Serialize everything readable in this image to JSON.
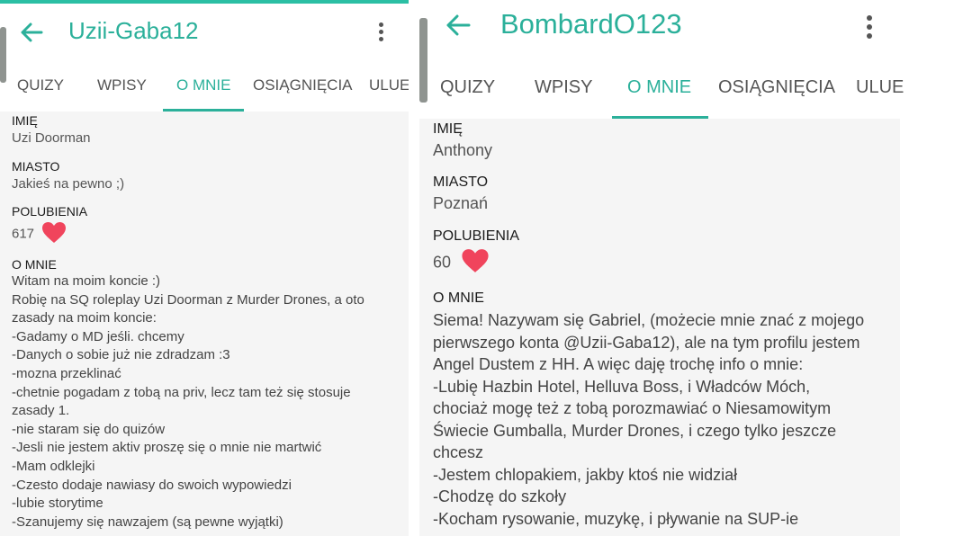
{
  "left": {
    "app_bar": {
      "title": "Uzii-Gaba12"
    },
    "tabs": [
      "QUIZY",
      "WPISY",
      "O MNIE",
      "OSIĄGNIĘCIA",
      "ULUE"
    ],
    "active_tab": "O MNIE",
    "fields": {
      "name_label": "IMIĘ",
      "name_value": "Uzi Doorman",
      "city_label": "MIASTO",
      "city_value": "Jakieś na pewno ;)",
      "likes_label": "POLUBIENIA",
      "likes_value": "617",
      "about_label": "O MNIE"
    },
    "about_lines": [
      "Witam na moim koncie :)",
      "Robię na SQ roleplay Uzi Doorman z Murder Drones, a oto",
      "zasady na moim koncie:",
      "-Gadamy o MD jeśli. chcemy",
      "-Danych o sobie już nie zdradzam :3",
      "-mozna przeklinać",
      "-chetnie pogadam z tobą na priv, lecz tam też się stosuje",
      "zasady 1.",
      "-nie staram się do quizów",
      "-Jesli nie jestem aktiv proszę się o mnie nie martwić",
      "-Mam odklejki",
      "-Czesto dodaje nawiasy do swoich wypowiedzi",
      "-lubie storytime",
      "-Szanujemy się nawzajem (są pewne wyjątki)"
    ]
  },
  "right": {
    "app_bar": {
      "title": "BombardO123"
    },
    "tabs": [
      "QUIZY",
      "WPISY",
      "O MNIE",
      "OSIĄGNIĘCIA",
      "ULUE"
    ],
    "active_tab": "O MNIE",
    "fields": {
      "name_label": "IMIĘ",
      "name_value": "Anthony",
      "city_label": "MIASTO",
      "city_value": "Poznań",
      "likes_label": "POLUBIENIA",
      "likes_value": "60",
      "about_label": "O MNIE"
    },
    "about_lines": [
      "Siema! Nazywam się Gabriel, (możecie mnie znać z mojego",
      "pierwszego konta @Uzii-Gaba12), ale na tym profilu jestem",
      "Angel Dustem z HH. A więc daję trochę info o mnie:",
      "-Lubię Hazbin Hotel, Helluva Boss, i Władców Móch,",
      "chociaż mogę też z tobą porozmawiać o Niesamowitym",
      "Świecie Gumballa, Murder Drones, i czego tylko jeszcze",
      "chcesz",
      "-Jestem chlopakiem, jakby ktoś nie widział",
      "-Chodzę do szkoły",
      "-Kocham rysowanie, muzykę, i pływanie na SUP-ie"
    ]
  },
  "icons": {
    "back": "arrow-left-icon",
    "menu": "more-vertical-icon",
    "like": "heart-icon"
  },
  "colors": {
    "accent": "#2bb09a",
    "heart": "#f0445c",
    "content_bg": "#f5f5f5"
  }
}
